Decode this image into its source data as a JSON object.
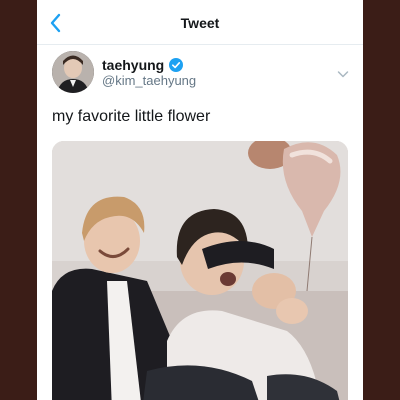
{
  "nav": {
    "title": "Tweet",
    "back_icon": "chevron-left-icon"
  },
  "author": {
    "display_name": "taehyung",
    "handle": "@kim_taehyung",
    "verified_icon": "verified-badge-icon",
    "menu_icon": "chevron-down-icon"
  },
  "tweet": {
    "text": "my favorite little flower"
  },
  "colors": {
    "accent": "#1da1f2",
    "frame": "#3b1d17",
    "text": "#14171a",
    "muted": "#657786"
  }
}
